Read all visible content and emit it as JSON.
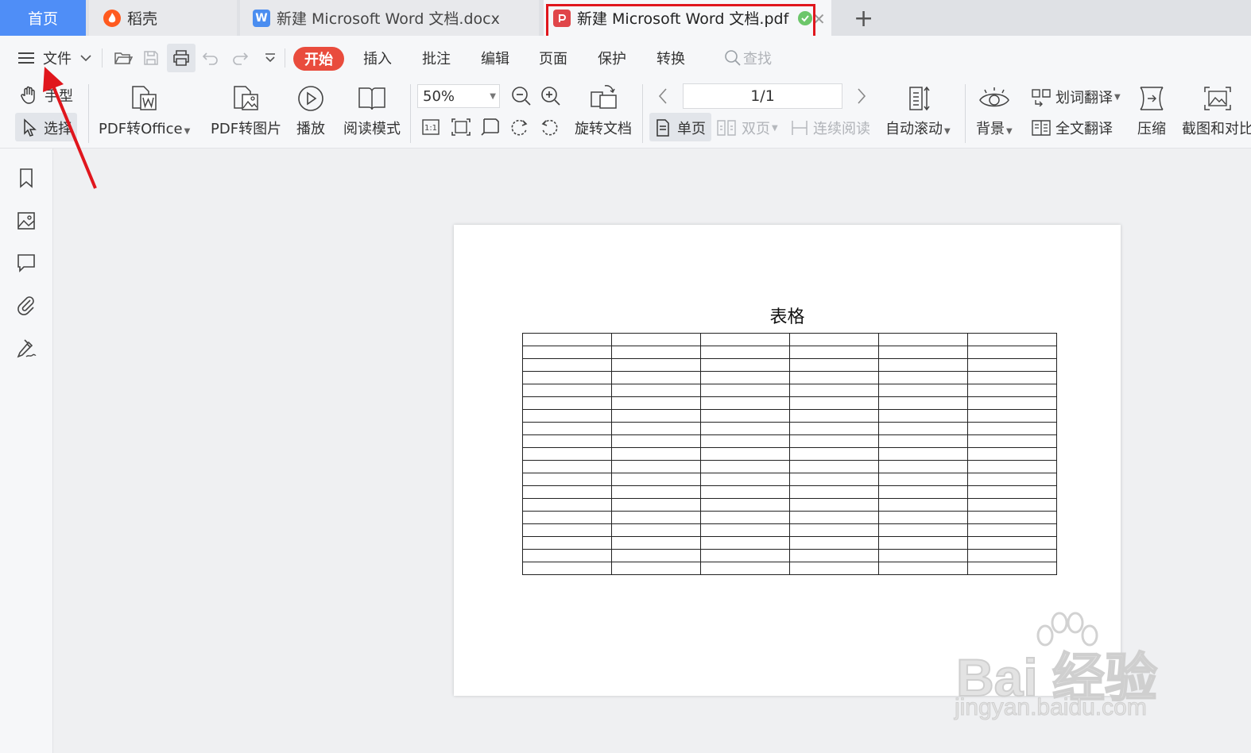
{
  "tabs": [
    {
      "label": "首页"
    },
    {
      "label": "稻壳"
    },
    {
      "label": "新建 Microsoft Word 文档.docx"
    },
    {
      "label": "新建 Microsoft Word 文档.pdf"
    }
  ],
  "colors": {
    "accent": "#4f8ef7",
    "start": "#e94c3d",
    "highlight": "#e0161d",
    "pdf": "#e0464a",
    "word": "#4a8df0"
  },
  "menu": {
    "file": "文件",
    "items": [
      "开始",
      "插入",
      "批注",
      "编辑",
      "页面",
      "保护",
      "转换"
    ],
    "search_placeholder": "查找"
  },
  "toolbar": {
    "hand": "手型",
    "select": "选择",
    "pdf_to_office": "PDF转Office",
    "pdf_to_image": "PDF转图片",
    "play": "播放",
    "read_mode": "阅读模式",
    "zoom": "50%",
    "rotate_doc": "旋转文档",
    "page_indicator": "1/1",
    "single_page": "单页",
    "double_page": "双页",
    "continuous": "连续阅读",
    "auto_scroll": "自动滚动",
    "word_translate": "划词翻译",
    "background": "背景",
    "full_translate": "全文翻译",
    "compress": "压缩",
    "screenshot_compare": "截图和对比",
    "actual_size": "1:1"
  },
  "document": {
    "title": "表格",
    "rows": 19,
    "cols": 6
  },
  "watermark": {
    "main": "Bai 经验",
    "sub": "jingyan.baidu.com"
  }
}
